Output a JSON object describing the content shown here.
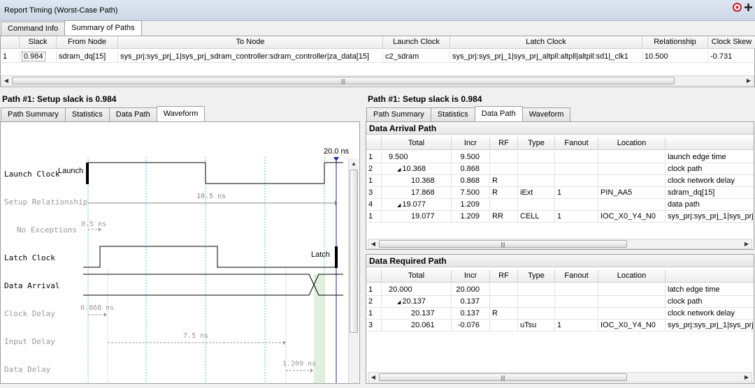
{
  "window": {
    "title": "Report Timing (Worst-Case Path)"
  },
  "top_tabs": [
    "Command Info",
    "Summary of Paths"
  ],
  "summary": {
    "columns": [
      "Slack",
      "From Node",
      "To Node",
      "Launch Clock",
      "Latch Clock",
      "Relationship",
      "Clock Skew"
    ],
    "row": {
      "idx": "1",
      "slack": "0.984",
      "from": "sdram_dq[15]",
      "to": "sys_prj:sys_prj_1|sys_prj_sdram_controller:sdram_controller|za_data[15]",
      "launch": "c2_sdram",
      "latch": "sys_prj:sys_prj_1|sys_prj_altpll:altpll|altpll:sd1|_clk1",
      "rel": "10.500",
      "skew": "-0.731"
    }
  },
  "left": {
    "title": "Path #1: Setup slack is 0.984",
    "tabs": [
      "Path Summary",
      "Statistics",
      "Data Path",
      "Waveform"
    ],
    "waveform": {
      "signals": [
        "Launch Clock",
        "Setup Relationship",
        "No Exceptions",
        "Latch Clock",
        "Data Arrival",
        "Clock Delay",
        "Input Delay",
        "Data Delay"
      ],
      "annotations": {
        "end_time": "20.0 ns",
        "launch": "Launch",
        "latch": "Latch",
        "setup": "10.5 ns",
        "noexc": "0.5 ns",
        "clkdelay": "0.868 ns",
        "indelay": "7.5 ns",
        "datadelay": "1.209 ns"
      }
    }
  },
  "right": {
    "title": "Path #1: Setup slack is 0.984",
    "tabs": [
      "Path Summary",
      "Statistics",
      "Data Path",
      "Waveform"
    ],
    "arrival": {
      "title": "Data Arrival Path",
      "columns": [
        "Total",
        "Incr",
        "RF",
        "Type",
        "Fanout",
        "Location",
        ""
      ],
      "rows": [
        {
          "n": "1",
          "total": "9.500",
          "incr": "9.500",
          "rf": "",
          "type": "",
          "fanout": "",
          "loc": "",
          "desc": "launch edge time"
        },
        {
          "n": "2",
          "total": "10.368",
          "incr": "0.868",
          "rf": "",
          "type": "",
          "fanout": "",
          "loc": "",
          "desc": "clock path"
        },
        {
          "n": "1",
          "total": "10.368",
          "incr": "0.868",
          "rf": "R",
          "type": "",
          "fanout": "",
          "loc": "",
          "desc": "clock network delay"
        },
        {
          "n": "3",
          "total": "17.868",
          "incr": "7.500",
          "rf": "R",
          "type": "iExt",
          "fanout": "1",
          "loc": "PIN_AA5",
          "desc": "sdram_dq[15]"
        },
        {
          "n": "4",
          "total": "19.077",
          "incr": "1.209",
          "rf": "",
          "type": "",
          "fanout": "",
          "loc": "",
          "desc": "data path"
        },
        {
          "n": "1",
          "total": "19.077",
          "incr": "1.209",
          "rf": "RR",
          "type": "CELL",
          "fanout": "1",
          "loc": "IOC_X0_Y4_N0",
          "desc": "sys_prj:sys_prj_1|sys_prj"
        }
      ]
    },
    "required": {
      "title": "Data Required Path",
      "columns": [
        "Total",
        "Incr",
        "RF",
        "Type",
        "Fanout",
        "Location",
        ""
      ],
      "rows": [
        {
          "n": "1",
          "total": "20.000",
          "incr": "20.000",
          "rf": "",
          "type": "",
          "fanout": "",
          "loc": "",
          "desc": "latch edge time"
        },
        {
          "n": "2",
          "total": "20.137",
          "incr": "0.137",
          "rf": "",
          "type": "",
          "fanout": "",
          "loc": "",
          "desc": "clock path"
        },
        {
          "n": "1",
          "total": "20.137",
          "incr": "0.137",
          "rf": "R",
          "type": "",
          "fanout": "",
          "loc": "",
          "desc": "clock network delay"
        },
        {
          "n": "3",
          "total": "20.061",
          "incr": "-0.076",
          "rf": "",
          "type": "uTsu",
          "fanout": "1",
          "loc": "IOC_X0_Y4_N0",
          "desc": "sys_prj:sys_prj_1|sys_prj"
        }
      ]
    }
  }
}
